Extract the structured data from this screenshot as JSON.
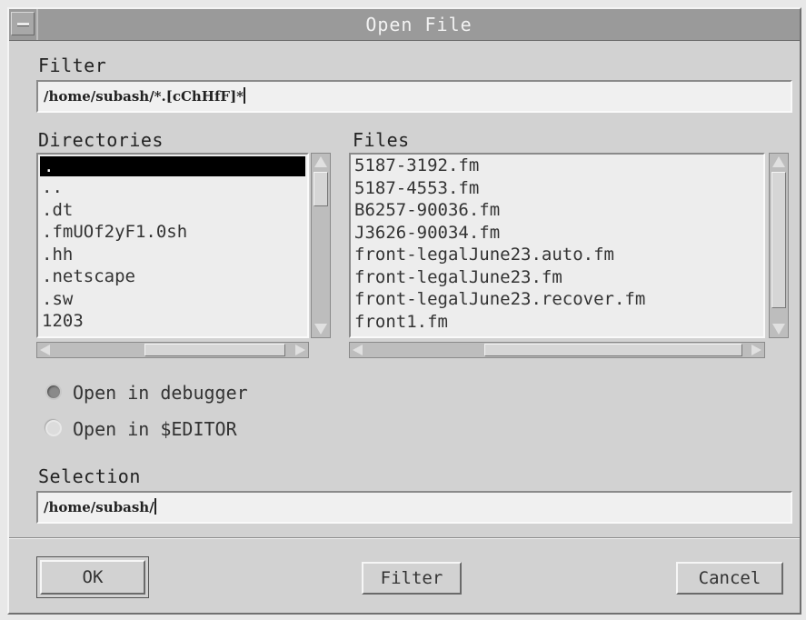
{
  "window": {
    "title": "Open File"
  },
  "filter": {
    "label": "Filter",
    "value": "/home/subash/*.[cChHfF]*"
  },
  "directories": {
    "label": "Directories",
    "items": [
      ".",
      "..",
      ".dt",
      ".fmUOf2yF1.0sh",
      ".hh",
      ".netscape",
      ".sw",
      "1203"
    ],
    "selected_index": 0
  },
  "files": {
    "label": "Files",
    "items": [
      "5187-3192.fm",
      "5187-4553.fm",
      "B6257-90036.fm",
      "J3626-90034.fm",
      "front-legalJune23.auto.fm",
      "front-legalJune23.fm",
      "front-legalJune23.recover.fm",
      "front1.fm"
    ]
  },
  "options": {
    "debugger": {
      "label": "Open in debugger",
      "selected": true
    },
    "editor": {
      "label": "Open in $EDITOR",
      "selected": false
    }
  },
  "selection": {
    "label": "Selection",
    "value": "/home/subash/"
  },
  "buttons": {
    "ok": "OK",
    "filter": "Filter",
    "cancel": "Cancel"
  },
  "icons": {
    "window_menu": "window-menu-icon",
    "scroll_up": "arrow-up-icon",
    "scroll_down": "arrow-down-icon",
    "scroll_left": "arrow-left-icon",
    "scroll_right": "arrow-right-icon"
  }
}
